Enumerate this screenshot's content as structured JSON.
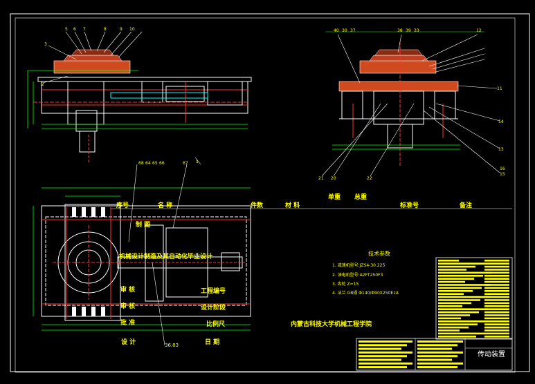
{
  "drawing": {
    "title_block": {
      "name": "传动装置",
      "school": "内蒙古科技大学机械工程学院",
      "project": "机械设计制造及其自动化毕业设计"
    },
    "table_headers": [
      "序号",
      "名  称",
      "件数",
      "材  料",
      "单重",
      "总重",
      "标准号",
      "备注"
    ],
    "sign_labels": {
      "designed": "设 计",
      "drawn": "制 图",
      "checked": "审 核",
      "audit": "审 核",
      "approved": "批 准",
      "stage": "工程编号",
      "design_stage": "设计阶段",
      "scale": "比例尺",
      "date": "日 期"
    },
    "tech": {
      "heading": "技术参数",
      "lines": [
        "1. 减速机型号:JZS4-30.225",
        "2. 油电机型号:A2FT250F3",
        "3. 齿轮 Z=15",
        "4. 法兰 GB规 Φ140/Φ90X250E1A"
      ]
    },
    "bottom_label": "36.83",
    "callouts_top_left": [
      "3",
      "5",
      "6",
      "7",
      "8",
      "9",
      "10",
      "2",
      "1"
    ],
    "callouts_top_right": [
      "40",
      "30",
      "37",
      "38",
      "39",
      "33",
      "12",
      "11",
      "14",
      "13",
      "16",
      "15",
      "21",
      "20",
      "22"
    ],
    "callouts_mid": [
      "68",
      "64",
      "65",
      "66",
      "67",
      "1"
    ]
  }
}
